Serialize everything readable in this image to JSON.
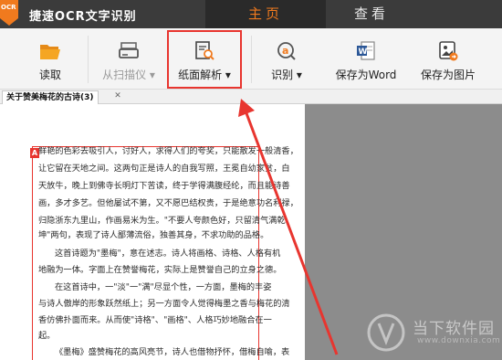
{
  "app": {
    "logo_text": "OCR",
    "title": "捷速OCR文字识别"
  },
  "tabs": {
    "home": "主页",
    "view": "查看"
  },
  "toolbar": {
    "read": "读取",
    "scanner": "从扫描仪 ▾",
    "paper_analysis": "纸面解析 ▾",
    "recognize": "识别 ▾",
    "save_word": "保存为Word",
    "save_image": "保存为图片"
  },
  "doc_tab": {
    "label": "关于赞美梅花的古诗(3)",
    "close": "✕"
  },
  "region_tag": "A",
  "document_lines": [
    "鲜艳的色彩去吸引人，讨好人，求得人们的夸奖，只能散发一般清香，",
    "让它留在天地之间。这两句正是诗人的自我写照，王冕自幼家贫，白",
    "天放牛，晚上到佛寺长明灯下苦读，终于学得满腹经纶，而且能诗善",
    "画，多才多艺。但他屡试不第，又不愿巴结权贵，于是绝意功名利禄，",
    "归隐浙东九里山，作画易米为生。\"不要人夸颜色好，只留清气满乾",
    "坤\"两句，表现了诗人鄙薄流俗，独善其身，不求功助的品格。",
    "这首诗题为\"墨梅\"，意在述志。诗人将画格、诗格、人格有机",
    "地融为一体。字面上在赞誉梅花，实际上是赞誉自己的立身之德。",
    "在这首诗中，一\"淡\"一\"满\"尽显个性，一方面，墨梅的丰姿",
    "与诗人傲岸的形象跃然纸上；另一方面令人觉得梅墨之香与梅花的清",
    "香仿佛扑面而来。从而使\"诗格\"、\"画格\"、人格巧妙地融合在一",
    "起。",
    "《墨梅》盛赞梅花的高风亮节，诗人也借物抒怀，借梅自喻，表"
  ],
  "watermark": {
    "brand": "当下软件园",
    "url": "www.downxia.com"
  },
  "colors": {
    "accent": "#f07a1e",
    "highlight": "#e8352f",
    "titlebar": "#3b3b3b"
  }
}
